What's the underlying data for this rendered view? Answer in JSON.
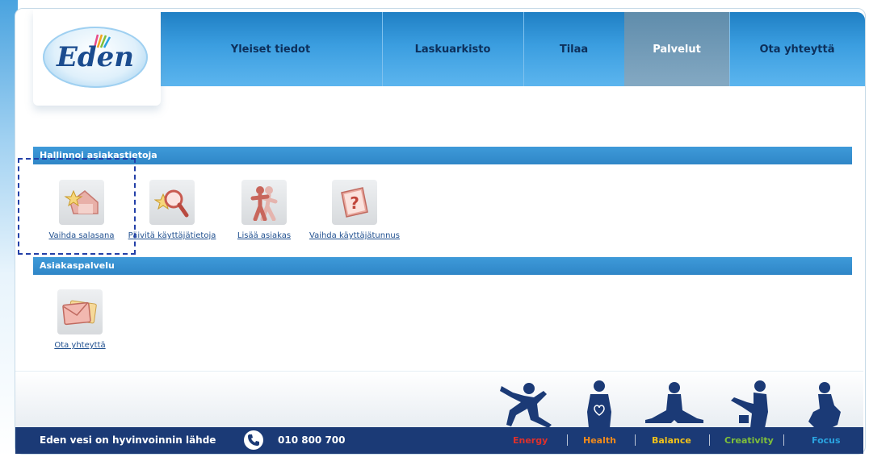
{
  "nav": {
    "items": [
      {
        "label": "Yleiset tiedot"
      },
      {
        "label": "Laskuarkisto"
      },
      {
        "label": "Tilaa"
      },
      {
        "label": "Palvelut"
      },
      {
        "label": "Ota yhteyttä"
      }
    ],
    "active": "Palvelut"
  },
  "logo": {
    "text": "Eden"
  },
  "sections": {
    "manage": {
      "title": "Hallinnoi asiakastietoja",
      "items": [
        {
          "label": "Vaihda salasana",
          "icon": "house-star-icon"
        },
        {
          "label": "Päivitä käyttäjätietoja",
          "icon": "magnifier-star-icon"
        },
        {
          "label": "Lisää asiakas",
          "icon": "people-icon"
        },
        {
          "label": "Vaihda käyttäjätunnus",
          "icon": "question-book-icon"
        }
      ]
    },
    "service": {
      "title": "Asiakaspalvelu",
      "items": [
        {
          "label": "Ota yhteyttä",
          "icon": "envelope-icon"
        }
      ]
    }
  },
  "footer": {
    "tagline": "Eden vesi on hyvinvoinnin lähde",
    "phone": "010 800 700",
    "values": [
      {
        "label": "Energy",
        "color": "#e0302a"
      },
      {
        "label": "Health",
        "color": "#f08a1c"
      },
      {
        "label": "Balance",
        "color": "#f2c21a"
      },
      {
        "label": "Creativity",
        "color": "#7fbf3a"
      },
      {
        "label": "Focus",
        "color": "#2aa3e0"
      }
    ]
  },
  "colors": {
    "nav_blue": "#3b9ee0",
    "nav_active": "#6f97b5",
    "section_bar": "#3393d3",
    "footer": "#1b3a76"
  }
}
